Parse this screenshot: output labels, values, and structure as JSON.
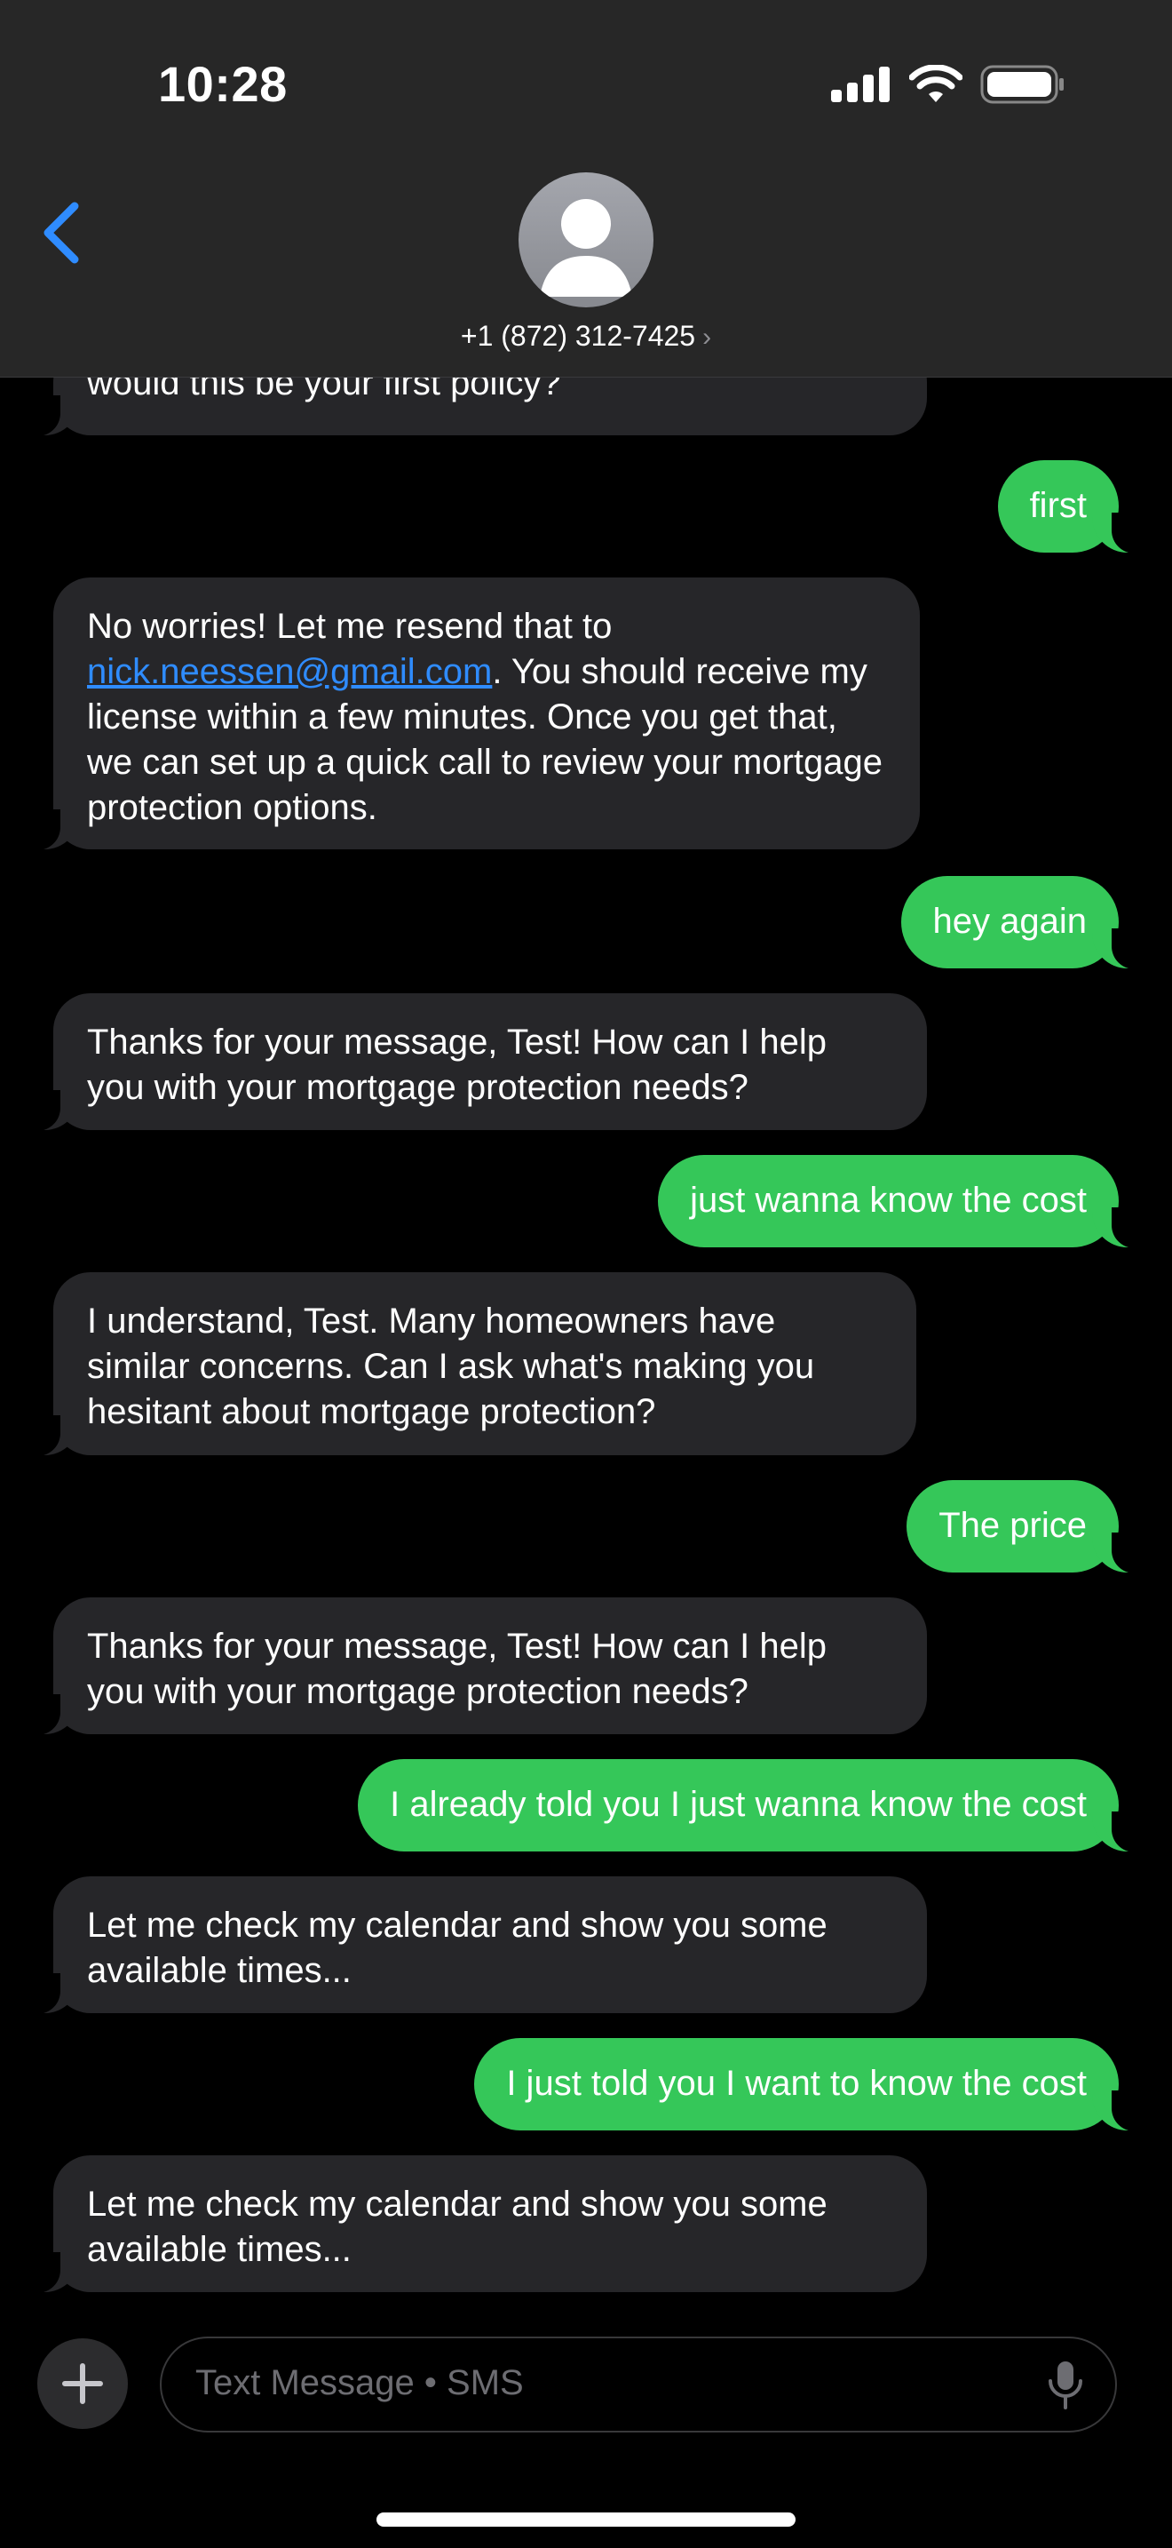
{
  "status_bar": {
    "time": "10:28"
  },
  "header": {
    "contact": "+1 (872) 312-7425",
    "chevron": "›"
  },
  "messages": [
    {
      "dir": "in",
      "text": "would this be your first policy?"
    },
    {
      "dir": "out",
      "text": "first"
    },
    {
      "dir": "in",
      "text_before": "No worries! Let me resend that to ",
      "link": "nick.neessen@gmail.com",
      "text_after": ". You should receive my license within a few minutes. Once you get that, we can set up a quick call to review your mortgage protection options."
    },
    {
      "dir": "out",
      "text": "hey again"
    },
    {
      "dir": "in",
      "text": "Thanks for your message, Test! How can I help you with your mortgage protection needs?"
    },
    {
      "dir": "out",
      "text": "just wanna know the cost"
    },
    {
      "dir": "in",
      "text": "I understand, Test. Many homeowners have similar concerns. Can I ask what's making you hesitant about mortgage protection?"
    },
    {
      "dir": "out",
      "text": "The price"
    },
    {
      "dir": "in",
      "text": "Thanks for your message, Test! How can I help you with your mortgage protection needs?"
    },
    {
      "dir": "out",
      "text": "I already told you I just wanna know the cost"
    },
    {
      "dir": "in",
      "text": "Let me check my calendar and show you some available times..."
    },
    {
      "dir": "out",
      "text": "I just told you I want to know the cost"
    },
    {
      "dir": "in",
      "text": "Let me check my calendar and show you some available times..."
    }
  ],
  "composer": {
    "placeholder": "Text Message • SMS"
  },
  "colors": {
    "outgoing": "#35c759",
    "incoming": "#262629",
    "accent": "#2f8cff",
    "header": "#272727"
  }
}
